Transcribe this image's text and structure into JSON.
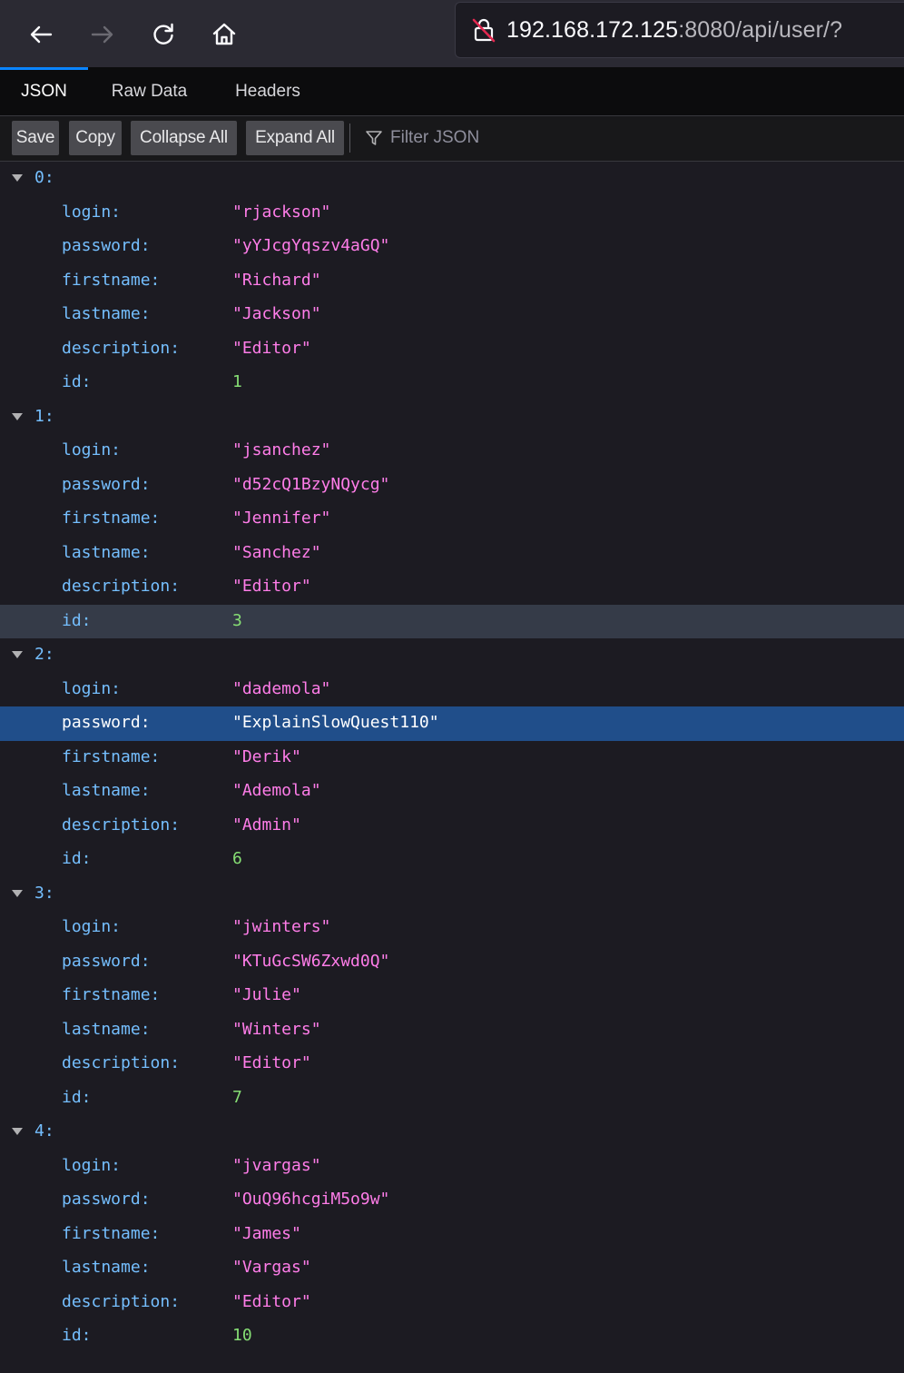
{
  "browser": {
    "url_host": "192.168.172.125",
    "url_rest": ":8080/api/user/?",
    "icons": [
      "back-arrow-icon",
      "forward-arrow-icon",
      "reload-icon",
      "home-icon",
      "insecure-lock-icon"
    ]
  },
  "viewer": {
    "tabs": [
      {
        "label": "JSON",
        "selected": true
      },
      {
        "label": "Raw Data",
        "selected": false
      },
      {
        "label": "Headers",
        "selected": false
      }
    ],
    "toolbar": {
      "save": "Save",
      "copy": "Copy",
      "collapse_all": "Collapse All",
      "expand_all": "Expand All",
      "filter_placeholder": "Filter JSON"
    }
  },
  "users": [
    {
      "index": "0:",
      "fields": [
        {
          "key": "login:",
          "value": "\"rjackson\"",
          "kind": "str"
        },
        {
          "key": "password:",
          "value": "\"yYJcgYqszv4aGQ\"",
          "kind": "str"
        },
        {
          "key": "firstname:",
          "value": "\"Richard\"",
          "kind": "str"
        },
        {
          "key": "lastname:",
          "value": "\"Jackson\"",
          "kind": "str"
        },
        {
          "key": "description:",
          "value": "\"Editor\"",
          "kind": "str"
        },
        {
          "key": "id:",
          "value": "1",
          "kind": "num"
        }
      ]
    },
    {
      "index": "1:",
      "fields": [
        {
          "key": "login:",
          "value": "\"jsanchez\"",
          "kind": "str"
        },
        {
          "key": "password:",
          "value": "\"d52cQ1BzyNQycg\"",
          "kind": "str"
        },
        {
          "key": "firstname:",
          "value": "\"Jennifer\"",
          "kind": "str"
        },
        {
          "key": "lastname:",
          "value": "\"Sanchez\"",
          "kind": "str"
        },
        {
          "key": "description:",
          "value": "\"Editor\"",
          "kind": "str"
        },
        {
          "key": "id:",
          "value": "3",
          "kind": "num",
          "state": "hover"
        }
      ]
    },
    {
      "index": "2:",
      "fields": [
        {
          "key": "login:",
          "value": "\"dademola\"",
          "kind": "str"
        },
        {
          "key": "password:",
          "value": "\"ExplainSlowQuest110\"",
          "kind": "str",
          "state": "sel"
        },
        {
          "key": "firstname:",
          "value": "\"Derik\"",
          "kind": "str"
        },
        {
          "key": "lastname:",
          "value": "\"Ademola\"",
          "kind": "str"
        },
        {
          "key": "description:",
          "value": "\"Admin\"",
          "kind": "str"
        },
        {
          "key": "id:",
          "value": "6",
          "kind": "num"
        }
      ]
    },
    {
      "index": "3:",
      "fields": [
        {
          "key": "login:",
          "value": "\"jwinters\"",
          "kind": "str"
        },
        {
          "key": "password:",
          "value": "\"KTuGcSW6Zxwd0Q\"",
          "kind": "str"
        },
        {
          "key": "firstname:",
          "value": "\"Julie\"",
          "kind": "str"
        },
        {
          "key": "lastname:",
          "value": "\"Winters\"",
          "kind": "str"
        },
        {
          "key": "description:",
          "value": "\"Editor\"",
          "kind": "str"
        },
        {
          "key": "id:",
          "value": "7",
          "kind": "num"
        }
      ]
    },
    {
      "index": "4:",
      "fields": [
        {
          "key": "login:",
          "value": "\"jvargas\"",
          "kind": "str"
        },
        {
          "key": "password:",
          "value": "\"OuQ96hcgiM5o9w\"",
          "kind": "str"
        },
        {
          "key": "firstname:",
          "value": "\"James\"",
          "kind": "str"
        },
        {
          "key": "lastname:",
          "value": "\"Vargas\"",
          "kind": "str"
        },
        {
          "key": "description:",
          "value": "\"Editor\"",
          "kind": "str"
        },
        {
          "key": "id:",
          "value": "10",
          "kind": "num"
        }
      ]
    }
  ]
}
